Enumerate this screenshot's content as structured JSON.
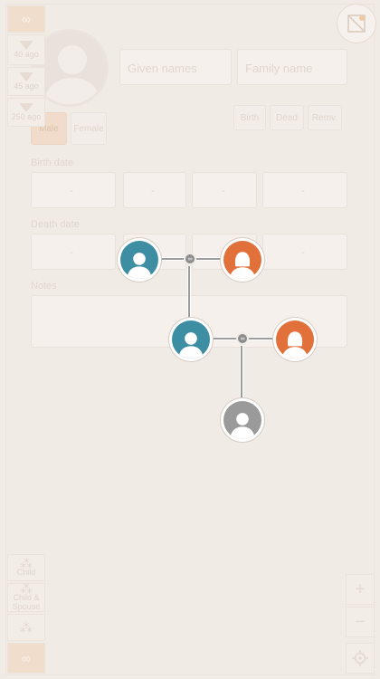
{
  "toolbar_left": {
    "top_symbol": "∞",
    "ages": [
      "40 ago",
      "45 ago",
      "250 ago"
    ],
    "child_label": "Child",
    "child_spouse_label": "Child & Spouse",
    "bottom_symbol": "∞"
  },
  "editor": {
    "first_name_placeholder": "Given names",
    "last_name_placeholder": "Family name",
    "gender_male": "Male",
    "gender_female": "Female",
    "status_buttons": [
      "Birth",
      "Dead",
      "Remv."
    ],
    "birth_label": "Birth date",
    "death_label": "Death date",
    "notes_label": "Notes",
    "dash": "-"
  },
  "tree": {
    "couple_knot_symbol": "∞",
    "nodes": [
      {
        "name": "father-node",
        "color": "teal",
        "gender": "male"
      },
      {
        "name": "mother-node",
        "color": "orange",
        "gender": "female"
      },
      {
        "name": "self-node",
        "color": "teal",
        "gender": "male"
      },
      {
        "name": "spouse-node",
        "color": "orange",
        "gender": "female"
      },
      {
        "name": "child-node",
        "color": "gray",
        "gender": "unknown"
      }
    ]
  },
  "zoom": {
    "plus": "+",
    "minus": "−"
  },
  "colors": {
    "male": "#3d8ea3",
    "female": "#e2703a",
    "unknown": "#9a9a9a",
    "link": "#9d9d9d",
    "background": "#f1ebe6"
  }
}
